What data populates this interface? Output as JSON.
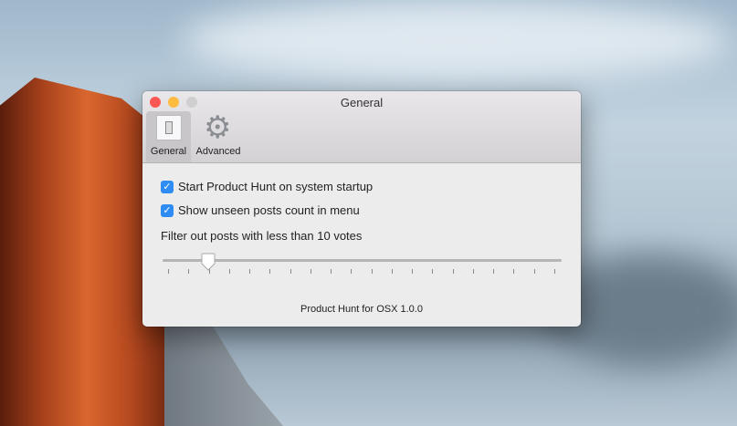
{
  "window": {
    "title": "General"
  },
  "toolbar": {
    "items": [
      {
        "label": "General",
        "icon": "switch-icon",
        "selected": true
      },
      {
        "label": "Advanced",
        "icon": "gear-icon",
        "selected": false
      }
    ]
  },
  "settings": {
    "start_on_startup": {
      "label": "Start Product Hunt on system startup",
      "checked": true
    },
    "show_unseen_count": {
      "label": "Show unseen posts count in menu",
      "checked": true
    },
    "filter_label": "Filter out posts with less than 10 votes",
    "slider": {
      "value": 10,
      "tick_count": 20,
      "position_fraction": 0.105
    }
  },
  "footer": {
    "version": "Product Hunt for OSX 1.0.0"
  },
  "colors": {
    "accent": "#2f8cf2",
    "close": "#fc5753",
    "minimize": "#fdbc40",
    "zoom_disabled": "#cfcfcf"
  }
}
